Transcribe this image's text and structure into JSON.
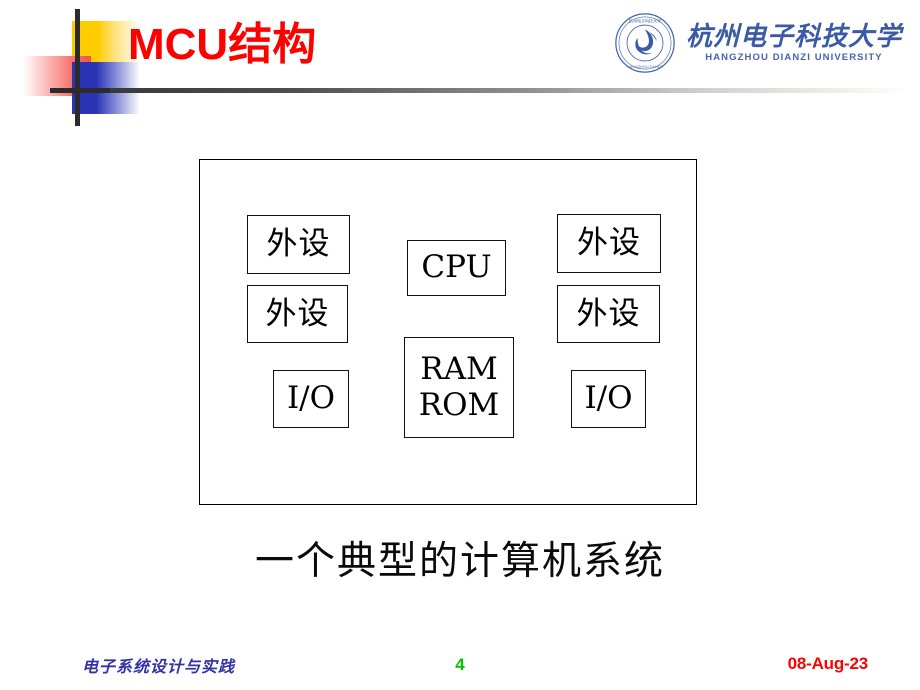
{
  "slide": {
    "title_latin": "MCU",
    "title_cjk": "结构",
    "title_full": "MCU结构"
  },
  "branding": {
    "seal_icon": "university-seal-icon",
    "name_cn": "杭州电子科技大学",
    "name_en": "HANGZHOU DIANZI UNIVERSITY",
    "color": "#3B5AA6"
  },
  "decoration": {
    "squares": [
      {
        "name": "yellow-square",
        "color": "#FFCC00"
      },
      {
        "name": "pink-square",
        "color": "#F4524E"
      },
      {
        "name": "blue-square",
        "color": "#2B33B5"
      }
    ],
    "cross_color": "#2B2B2B",
    "rule_color": "#3A3A3A"
  },
  "diagram": {
    "caption": "一个典型的计算机系统",
    "nodes": [
      {
        "id": "peripheral-left-1",
        "label": "外设"
      },
      {
        "id": "peripheral-left-2",
        "label": "外设"
      },
      {
        "id": "io-left",
        "label": "I/O"
      },
      {
        "id": "cpu",
        "label": "CPU"
      },
      {
        "id": "memory-ram",
        "label": "RAM"
      },
      {
        "id": "memory-rom",
        "label": "ROM"
      },
      {
        "id": "peripheral-right-1",
        "label": "外设"
      },
      {
        "id": "peripheral-right-2",
        "label": "外设"
      },
      {
        "id": "io-right",
        "label": "I/O"
      }
    ]
  },
  "footer": {
    "course": "电子系统设计与实践",
    "course_color": "#3333A8",
    "page_number": "4",
    "page_color": "#00C400",
    "date": "08-Aug-23",
    "date_color": "#FF0000"
  }
}
